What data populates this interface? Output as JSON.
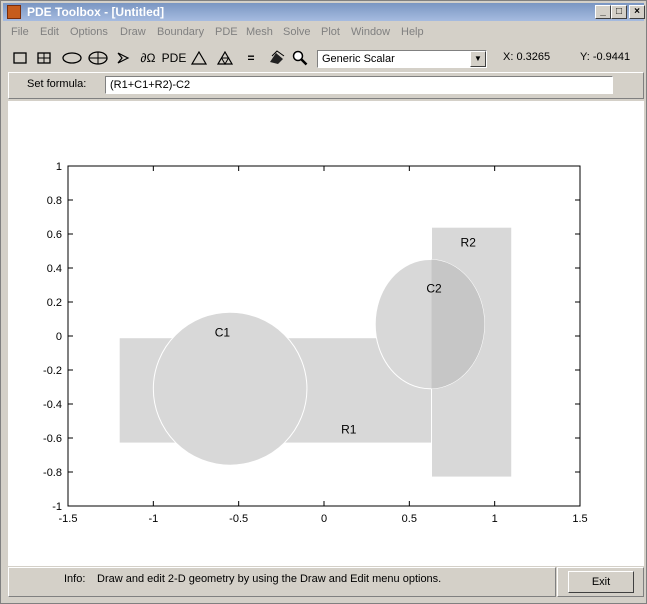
{
  "window": {
    "title": "PDE Toolbox - [Untitled]",
    "minimize": "_",
    "maximize": "□",
    "close": "×"
  },
  "menu": [
    "File",
    "Edit",
    "Options",
    "Draw",
    "Boundary",
    "PDE",
    "Mesh",
    "Solve",
    "Plot",
    "Window",
    "Help"
  ],
  "toolbar": {
    "tools": [
      "rectangle-icon",
      "centered-rectangle-icon",
      "ellipse-icon",
      "centered-ellipse-icon",
      "polygon-icon",
      "boundary-mode-icon",
      "pde-spec-icon",
      "init-mesh-icon",
      "refine-mesh-icon",
      "solve-icon",
      "plot-icon",
      "zoom-icon"
    ],
    "boundary_label": "∂Ω",
    "pde_label": "PDE",
    "equals_label": "=",
    "application": "Generic Scalar",
    "coord_x": "X: 0.3265",
    "coord_y": "Y: -0.9441"
  },
  "formula": {
    "label": "Set formula:",
    "value": "(R1+C1+R2)-C2"
  },
  "plot": {
    "x_ticks": [
      "-1.5",
      "-1",
      "-0.5",
      "0",
      "0.5",
      "1",
      "1.5"
    ],
    "y_ticks": [
      "1",
      "0.8",
      "0.6",
      "0.4",
      "0.2",
      "0",
      "-0.2",
      "-0.4",
      "-0.6",
      "-0.8",
      "-1"
    ],
    "xlim": [
      -1.5,
      1.5
    ],
    "ylim": [
      -1,
      1
    ],
    "shapes": {
      "R1": {
        "label": "R1",
        "x0": -1.2,
        "x1": 1.1,
        "y0": -0.63,
        "y1": -0.01
      },
      "C1": {
        "label": "C1",
        "cx": -0.55,
        "cy": -0.31,
        "rx": 0.45,
        "ry": 0.45
      },
      "R2": {
        "label": "R2",
        "x0": 0.63,
        "x1": 1.1,
        "y0": -0.83,
        "y1": 0.64
      },
      "C2": {
        "label": "C2",
        "cx": 0.62,
        "cy": 0.07,
        "rx": 0.32,
        "ry": 0.38
      }
    },
    "colors": {
      "fill": "#d8d8d8",
      "overlap": "#c6c6c6",
      "edge": "#ffffff"
    }
  },
  "status": {
    "info_label": "Info:",
    "message": "Draw and edit 2-D geometry by using the Draw and Edit menu options."
  },
  "exit_label": "Exit"
}
